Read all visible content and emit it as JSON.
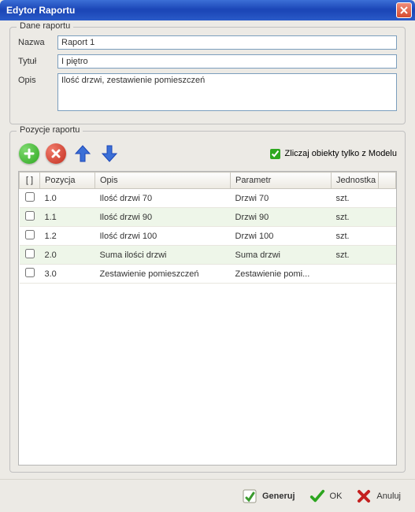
{
  "window": {
    "title": "Edytor Raportu"
  },
  "groups": {
    "dane": "Dane raportu",
    "pozycje": "Pozycje raportu"
  },
  "form": {
    "name_label": "Nazwa",
    "name_value": "Raport 1",
    "title_label": "Tytuł",
    "title_value": "I piętro",
    "desc_label": "Opis",
    "desc_value": "Ilość drzwi, zestawienie pomieszczeń"
  },
  "toolbar": {
    "count_from_model_label": "Zliczaj obiekty tylko z Modelu",
    "count_from_model_checked": true
  },
  "grid": {
    "headers": {
      "checkbox": "[ ]",
      "pozycja": "Pozycja",
      "opis": "Opis",
      "parametr": "Parametr",
      "jednostka": "Jednostka"
    },
    "rows": [
      {
        "pozycja": "1.0",
        "opis": "Ilość drzwi 70",
        "parametr": "Drzwi 70",
        "jednostka": "szt."
      },
      {
        "pozycja": "1.1",
        "opis": "Ilość drzwi 90",
        "parametr": "Drzwi 90",
        "jednostka": "szt."
      },
      {
        "pozycja": "1.2",
        "opis": "Ilość drzwi 100",
        "parametr": "Drzwi 100",
        "jednostka": "szt."
      },
      {
        "pozycja": "2.0",
        "opis": "Suma ilości drzwi",
        "parametr": "Suma drzwi",
        "jednostka": "szt."
      },
      {
        "pozycja": "3.0",
        "opis": "Zestawienie pomieszczeń",
        "parametr": "Zestawienie pomi...",
        "jednostka": ""
      }
    ]
  },
  "footer": {
    "generate": "Generuj",
    "ok": "OK",
    "cancel": "Anuluj"
  },
  "icons": {
    "add": "add-icon",
    "delete": "delete-icon",
    "up": "arrow-up-icon",
    "down": "arrow-down-icon",
    "close": "close-icon",
    "generate": "generate-icon",
    "ok": "checkmark-icon",
    "cancel": "cross-icon"
  }
}
